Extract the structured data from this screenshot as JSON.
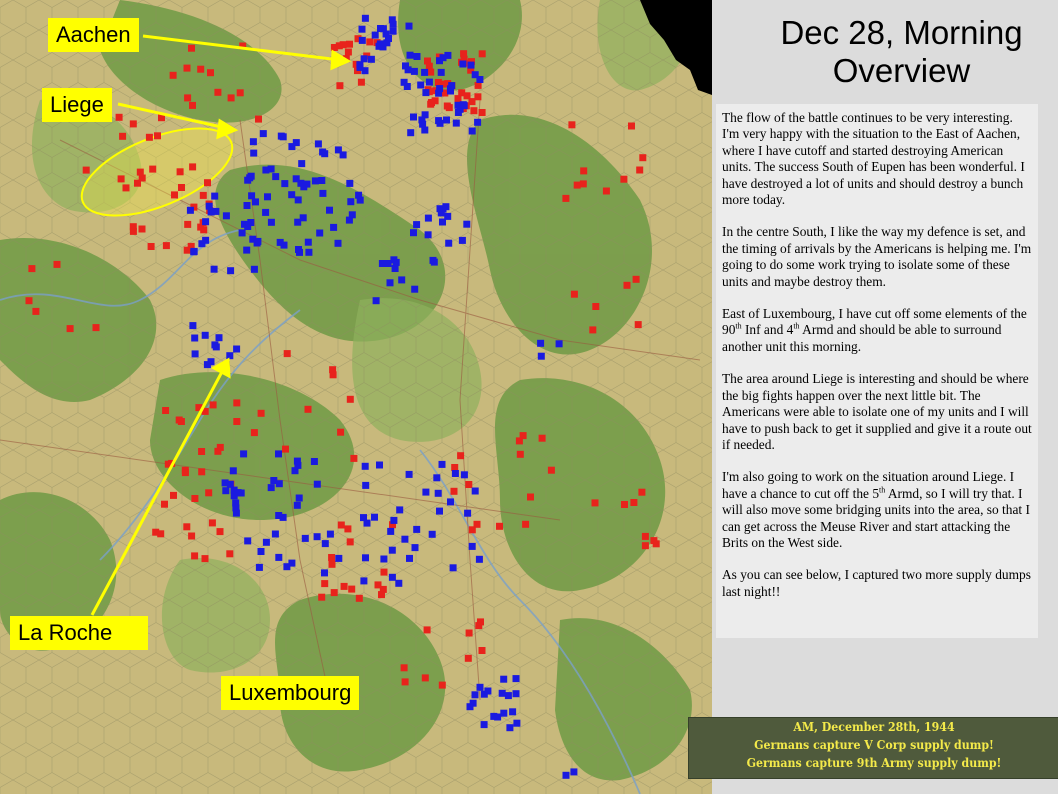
{
  "title": {
    "line1": "Dec 28, Morning",
    "line2": "Overview"
  },
  "labels": {
    "aachen": "Aachen",
    "liege": "Liege",
    "la_roche": "La Roche",
    "luxembourg": "Luxembourg"
  },
  "report": {
    "p1": "The flow of the battle continues to be very interesting.  I'm very happy with the situation to the East of Aachen, where I have cutoff and started destroying American units.  The success South of Eupen has been wonderful.  I have destroyed a lot of units and should destroy a bunch more today.",
    "p2": "In the centre South, I like the way my defence is set, and the timing of arrivals by the Americans is helping me.  I'm going to do some work trying to isolate some of these units and maybe destroy them.",
    "p3a": "East of Luxembourg, I have cut off some elements of the 90",
    "p3b": " Inf and 4",
    "p3c": " Armd and should be able to surround another unit this morning.",
    "th": "th",
    "p4": "The area around Liege is interesting and should be where the big fights happen over the next little bit.  The Americans were able to isolate one of my units and I will have to push back to get it supplied and give it a route out if needed.",
    "p5a": "I'm also going to work on the situation around Liege.  I have a chance to cut off the 5",
    "p5b": " Armd, so I will try that.  I will also move some bridging units into the area, so that I can get across the Meuse River and start attacking the Brits on the West side.",
    "p6": "As you can see below, I captured two more supply dumps last night!!"
  },
  "banner": {
    "line1": "AM, December 28th, 1944",
    "line2": "Germans capture V Corp supply dump!",
    "line3": "Germans capture 9th Army supply dump!"
  },
  "colors": {
    "german_units": "#e8231c",
    "allied_units": "#1a1ae0",
    "callout": "#ffff00",
    "banner_bg": "#4f5a3c",
    "banner_text": "#f4ea4a",
    "forest": "#6f9a45",
    "open": "#c9b879"
  }
}
